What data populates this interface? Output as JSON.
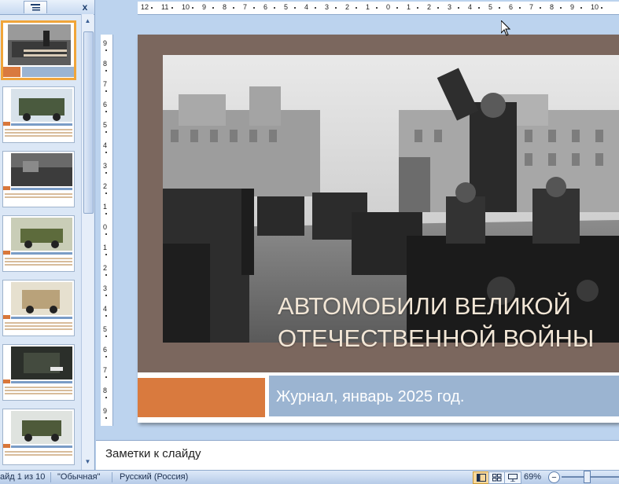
{
  "left_panel": {
    "tab_icon": "outline-icon",
    "close_label": "x",
    "thumbnails": [
      {
        "theme": "parade",
        "selected": true
      },
      {
        "theme": "truck-green",
        "selected": false
      },
      {
        "theme": "ruins",
        "selected": false
      },
      {
        "theme": "sedan",
        "selected": false
      },
      {
        "theme": "ambulance",
        "selected": false
      },
      {
        "theme": "dark-truck",
        "selected": false
      },
      {
        "theme": "armored-car",
        "selected": false
      }
    ]
  },
  "ruler": {
    "h_ticks": [
      "12",
      "11",
      "10",
      "9",
      "8",
      "7",
      "6",
      "5",
      "4",
      "3",
      "2",
      "1",
      "0",
      "1",
      "2",
      "3",
      "4",
      "5",
      "6",
      "7",
      "8",
      "9",
      "10"
    ],
    "v_ticks": [
      "9",
      "8",
      "7",
      "6",
      "5",
      "4",
      "3",
      "2",
      "1",
      "0",
      "1",
      "2",
      "3",
      "4",
      "5",
      "6",
      "7",
      "8",
      "9"
    ]
  },
  "slide": {
    "title_line1": "АВТОМОБИЛИ ВЕЛИКОЙ",
    "title_line2": "ОТЕЧЕСТВЕННОЙ ВОЙНЫ",
    "subtitle": "Журнал, январь 2025 год.",
    "colors": {
      "frame": "#7b675e",
      "orange": "#d97a3e",
      "blue": "#9bb4d1",
      "title": "#f2e6d6"
    }
  },
  "notes": {
    "placeholder": "Заметки к слайду"
  },
  "status_bar": {
    "slide_counter": "айд 1 из 10",
    "theme": "\"Обычная\"",
    "language": "Русский (Россия)",
    "zoom": "69%",
    "zoom_fraction": 0.69
  }
}
